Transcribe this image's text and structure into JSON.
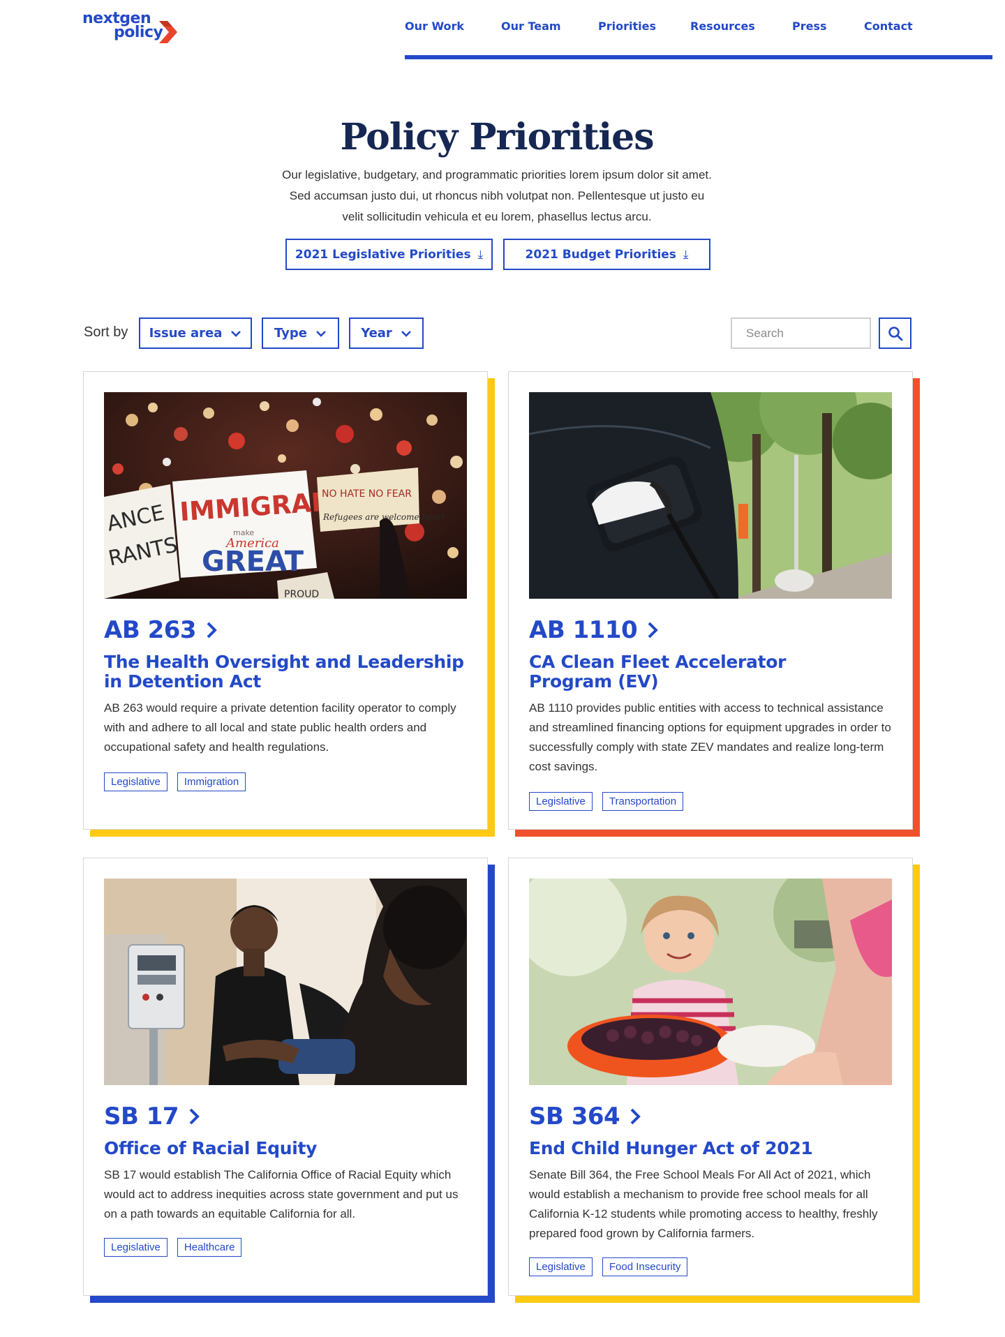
{
  "brand": {
    "logo_line1": "nextgen",
    "logo_line2": "policy",
    "primary_color": "#2349c8",
    "logo_arrow_color": "#e8452c"
  },
  "nav": {
    "items": [
      "Our Work",
      "Our Team",
      "Priorities",
      "Resources",
      "Press",
      "Contact"
    ]
  },
  "hero": {
    "title": "Policy Priorities",
    "text_lines": [
      "Our legislative, budgetary, and programmatic priorities lorem ipsum dolor sit amet.",
      "Sed accumsan justo dui, ut rhoncus nibh volutpat non. Pellentesque ut justo eu",
      "velit sollicitudin vehicula et eu lorem, phasellus lectus arcu."
    ],
    "buttons": [
      {
        "label": "2021 Legislative Priorities",
        "icon": "download-icon"
      },
      {
        "label": "2021 Budget Priorities",
        "icon": "download-icon"
      }
    ]
  },
  "filters": {
    "sort_label": "Sort by",
    "options": [
      "Issue area",
      "Type",
      "Year"
    ],
    "search_placeholder": "Search",
    "search_icon": "search-icon"
  },
  "cards": [
    {
      "bill": "AB 263",
      "title": "The Health Oversight and Leadership in Detention Act",
      "description": "AB 263 would require a private detention facility operator to comply with and adhere to all local and state public health orders and occupational safety and health regulations.",
      "tags": [
        "Legislative",
        "Immigration"
      ],
      "accent": "#ffc914",
      "image": "protest-signs-photo",
      "image_text": {
        "sign_main": "IMMIGRANTS",
        "sign_make": "make",
        "sign_america": "America",
        "sign_great": "GREAT",
        "sign_right_1": "NO HATE NO FEAR",
        "sign_right_2": "Refugees are welcome here!",
        "sign_left_1": "ANCE",
        "sign_left_2": "RANTS",
        "sign_bottom": "PROUD"
      }
    },
    {
      "bill": "AB 1110",
      "title": "CA Clean Fleet Accelerator Program (EV)",
      "description": "AB 1110 provides public entities with access to technical assistance and streamlined financing options for equipment upgrades in order to successfully comply with state ZEV mandates and realize long-term cost savings.",
      "tags": [
        "Legislative",
        "Transportation"
      ],
      "accent": "#f0512d",
      "image": "ev-charger-photo"
    },
    {
      "bill": "SB 17",
      "title": "Office of Racial Equity",
      "description": "SB 17 would establish The California Office of Racial Equity which would act to address inequities across state government and put us on a path towards an equitable California for all.",
      "tags": [
        "Legislative",
        "Healthcare"
      ],
      "accent": "#2349c8",
      "image": "healthcare-worker-photo"
    },
    {
      "bill": "SB 364",
      "title": "End Child Hunger Act of 2021",
      "description": "Senate Bill 364, the Free School Meals For All Act of 2021, which would establish a mechanism to provide free school meals for all California K-12 students while promoting access to healthy, freshly prepared food grown by California farmers.",
      "tags": [
        "Legislative",
        "Food Insecurity"
      ],
      "accent": "#ffc914",
      "image": "child-eating-photo"
    }
  ]
}
